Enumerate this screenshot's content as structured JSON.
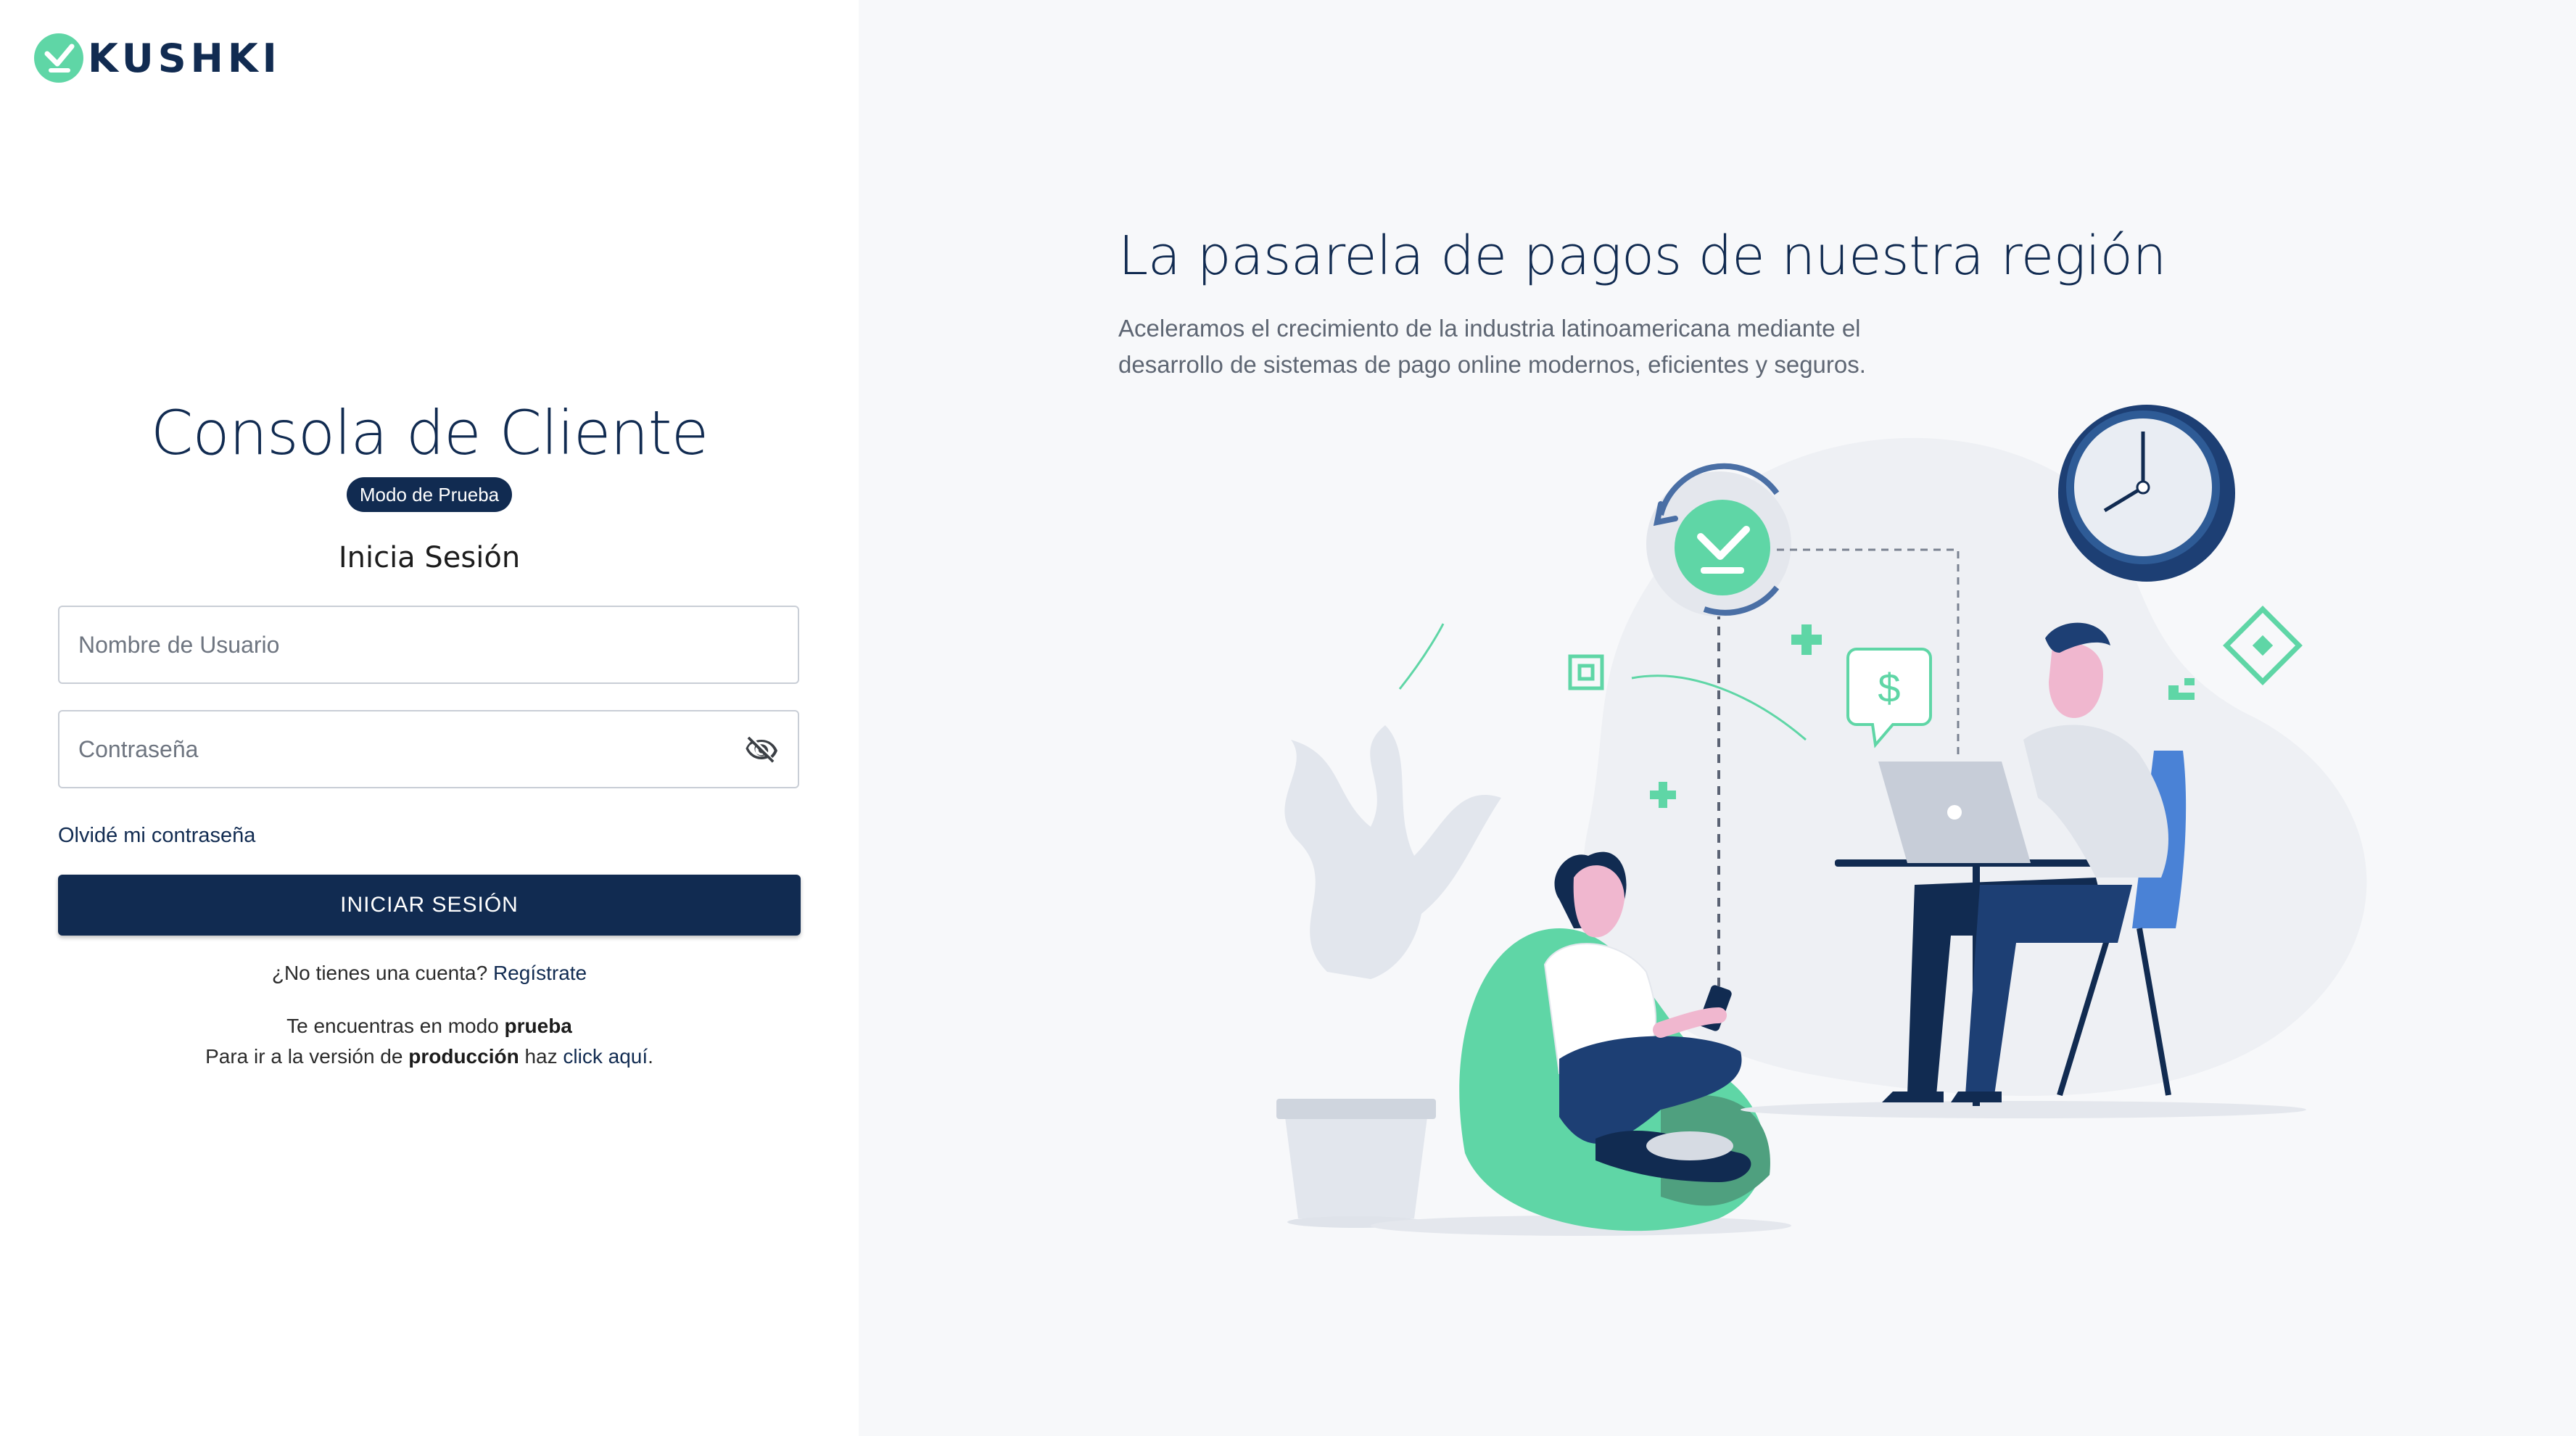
{
  "brand": {
    "name": "KUSHKI",
    "accent": "#5fd6a6",
    "primary": "#112b51"
  },
  "login": {
    "title": "Consola de Cliente",
    "badge": "Modo de Prueba",
    "heading": "Inicia Sesión",
    "username_placeholder": "Nombre de Usuario",
    "password_placeholder": "Contraseña",
    "forgot_link": "Olvidé mi contraseña",
    "submit_label": "INICIAR SESIÓN",
    "register_prompt": "¿No tienes una cuenta?",
    "register_link": "Regístrate",
    "mode_line_prefix": "Te encuentras en modo",
    "mode_name": "prueba",
    "prod_line_prefix": "Para ir a la versión de",
    "prod_word": "producción",
    "prod_line_middle": "haz",
    "prod_link": "click aquí",
    "prod_line_suffix": "."
  },
  "hero": {
    "title": "La pasarela de pagos de nuestra región",
    "subtitle": "Aceleramos el crecimiento de la industria latinoamericana mediante el desarrollo de sistemas de pago online modernos, eficientes y seguros.",
    "speech_bubble_symbol": "$"
  },
  "icons": {
    "logo": "kushki-check-icon",
    "password_toggle": "eye-off-icon"
  }
}
